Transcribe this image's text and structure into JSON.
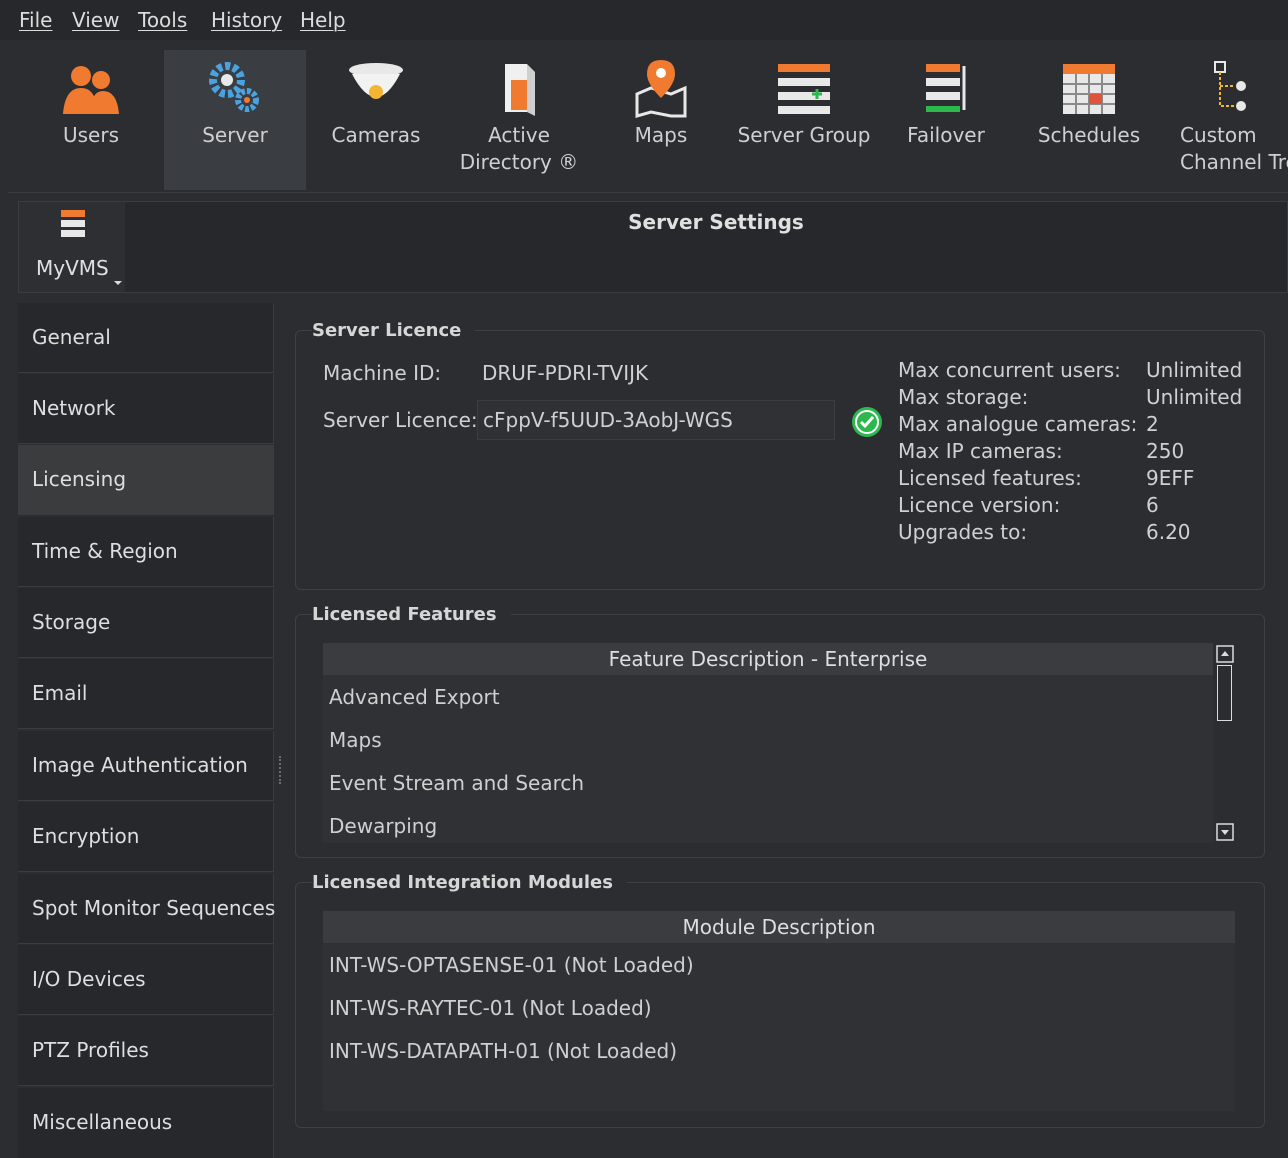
{
  "menu": [
    "File",
    "View",
    "Tools",
    "History",
    "Help"
  ],
  "toolbar": [
    {
      "label": "Users",
      "icon": "users-icon"
    },
    {
      "label": "Server",
      "icon": "server-gear-icon",
      "active": true
    },
    {
      "label": "Cameras",
      "icon": "dome-camera-icon"
    },
    {
      "label": "Active\nDirectory ®",
      "icon": "active-directory-icon"
    },
    {
      "label": "Maps",
      "icon": "map-pin-icon"
    },
    {
      "label": "Server Group",
      "icon": "server-group-icon"
    },
    {
      "label": "Failover",
      "icon": "failover-icon"
    },
    {
      "label": "Schedules",
      "icon": "calendar-icon"
    },
    {
      "label": "Custom\nChannel Tree",
      "icon": "channel-tree-icon"
    }
  ],
  "header": {
    "server_name": "MyVMS",
    "title": "Server Settings"
  },
  "sidebar": [
    "General",
    "Network",
    "Licensing",
    "Time & Region",
    "Storage",
    "Email",
    "Image Authentication",
    "Encryption",
    "Spot Monitor Sequences",
    "I/O Devices",
    "PTZ Profiles",
    "Miscellaneous"
  ],
  "sidebar_active": "Licensing",
  "licence": {
    "group_title": "Server Licence",
    "machine_id_label": "Machine ID:",
    "machine_id": "DRUF-PDRI-TVIJK",
    "licence_label": "Server Licence:",
    "licence_value": "cFppV-f5UUD-3AobJ-WGS",
    "status": "valid",
    "stats": [
      {
        "label": "Max concurrent users:",
        "value": "Unlimited"
      },
      {
        "label": "Max storage:",
        "value": "Unlimited"
      },
      {
        "label": "Max analogue cameras:",
        "value": "2"
      },
      {
        "label": "Max IP cameras:",
        "value": "250"
      },
      {
        "label": "Licensed features:",
        "value": "9EFF"
      },
      {
        "label": "Licence version:",
        "value": "6"
      },
      {
        "label": "Upgrades to:",
        "value": "6.20"
      }
    ]
  },
  "features": {
    "group_title": "Licensed Features",
    "column": "Feature Description - Enterprise",
    "rows": [
      "Advanced Export",
      "Maps",
      "Event Stream and Search",
      "Dewarping"
    ]
  },
  "modules": {
    "group_title": "Licensed Integration Modules",
    "column": "Module Description",
    "rows": [
      "INT-WS-OPTASENSE-01 (Not Loaded)",
      "INT-WS-RAYTEC-01 (Not Loaded)",
      "INT-WS-DATAPATH-01 (Not Loaded)"
    ]
  },
  "colors": {
    "accent_orange": "#f07a30",
    "valid_green": "#2db84d"
  }
}
